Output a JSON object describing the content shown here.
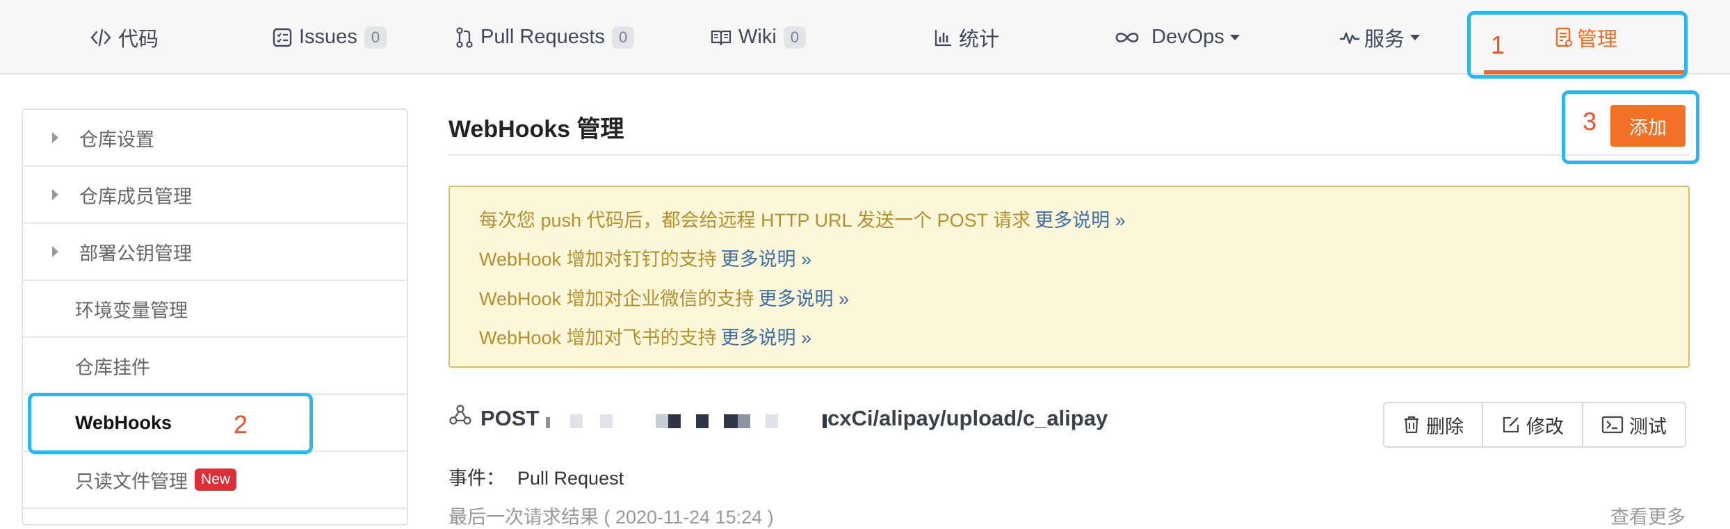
{
  "nav": {
    "tabs": [
      {
        "label": "代码",
        "icon": "code-icon"
      },
      {
        "label": "Issues",
        "icon": "issues-icon",
        "count": "0"
      },
      {
        "label": "Pull Requests",
        "icon": "pull-request-icon",
        "count": "0"
      },
      {
        "label": "Wiki",
        "icon": "book-icon",
        "count": "0"
      },
      {
        "label": "统计",
        "icon": "bar-chart-icon"
      },
      {
        "label": "DevOps",
        "icon": "infinity-icon",
        "dropdown": true
      },
      {
        "label": "服务",
        "icon": "pulse-icon",
        "dropdown": true
      },
      {
        "label": "管理",
        "icon": "document-icon",
        "active": true
      }
    ],
    "accent_color": "#f06a24"
  },
  "annotations": {
    "one": "1",
    "two": "2",
    "three": "3"
  },
  "sidebar": {
    "items": [
      {
        "label": "仓库设置",
        "expandable": true
      },
      {
        "label": "仓库成员管理",
        "expandable": true
      },
      {
        "label": "部署公钥管理",
        "expandable": true
      },
      {
        "label": "环境变量管理"
      },
      {
        "label": "仓库挂件"
      },
      {
        "label": "WebHooks",
        "active": true
      },
      {
        "label": "只读文件管理",
        "badge": "New"
      }
    ]
  },
  "main": {
    "title": "WebHooks 管理",
    "add_button": "添加",
    "notice": [
      {
        "text": "每次您 push 代码后，都会给远程 HTTP URL 发送一个 POST 请求",
        "link": "更多说明 »"
      },
      {
        "text": "WebHook 增加对钉钉的支持",
        "link": "更多说明 »"
      },
      {
        "text": "WebHook 增加对企业微信的支持",
        "link": "更多说明 »"
      },
      {
        "text": "WebHook 增加对飞书的支持",
        "link": "更多说明 »"
      }
    ],
    "hook": {
      "method": "POST",
      "url_visible": "cxCi/alipay/upload/c_alipay",
      "delete_label": "删除",
      "edit_label": "修改",
      "test_label": "测试"
    },
    "events_label": "事件：",
    "events_value": "Pull Request",
    "last_request": "最后一次请求结果 ( 2020-11-24 15:24 )",
    "more": "查看更多"
  }
}
